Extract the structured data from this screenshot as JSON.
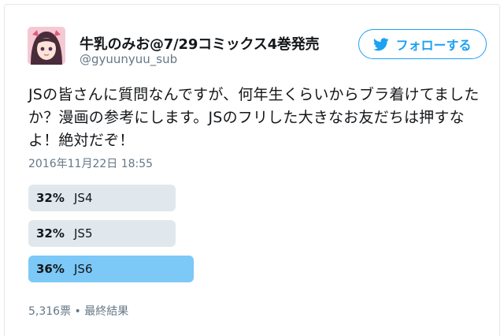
{
  "user": {
    "display_name": "牛乳のみお@7/29コミックス4巻発売",
    "handle": "@gyuunyuu_sub"
  },
  "follow_button": {
    "label": "フォローする",
    "icon": "twitter-bird-icon"
  },
  "tweet": {
    "text": "JSの皆さんに質問なんですが、何年生くらいからブラ着けてましたか？漫画の参考にします。JSのフリした大きなお友だちは押すなよ！絶対だぞ！",
    "timestamp": "2016年11月22日 18:55"
  },
  "poll": {
    "choices": [
      {
        "percent_label": "32%",
        "label": "JS4",
        "percent": 32,
        "winner": false
      },
      {
        "percent_label": "32%",
        "label": "JS5",
        "percent": 32,
        "winner": false
      },
      {
        "percent_label": "36%",
        "label": "JS6",
        "percent": 36,
        "winner": true
      }
    ],
    "footer": "5,316票 • 最終結果"
  },
  "colors": {
    "accent": "#1da1f2",
    "poll_winner": "#7cc8f7",
    "poll_other": "#e1e8ed",
    "secondary_text": "#657786"
  }
}
